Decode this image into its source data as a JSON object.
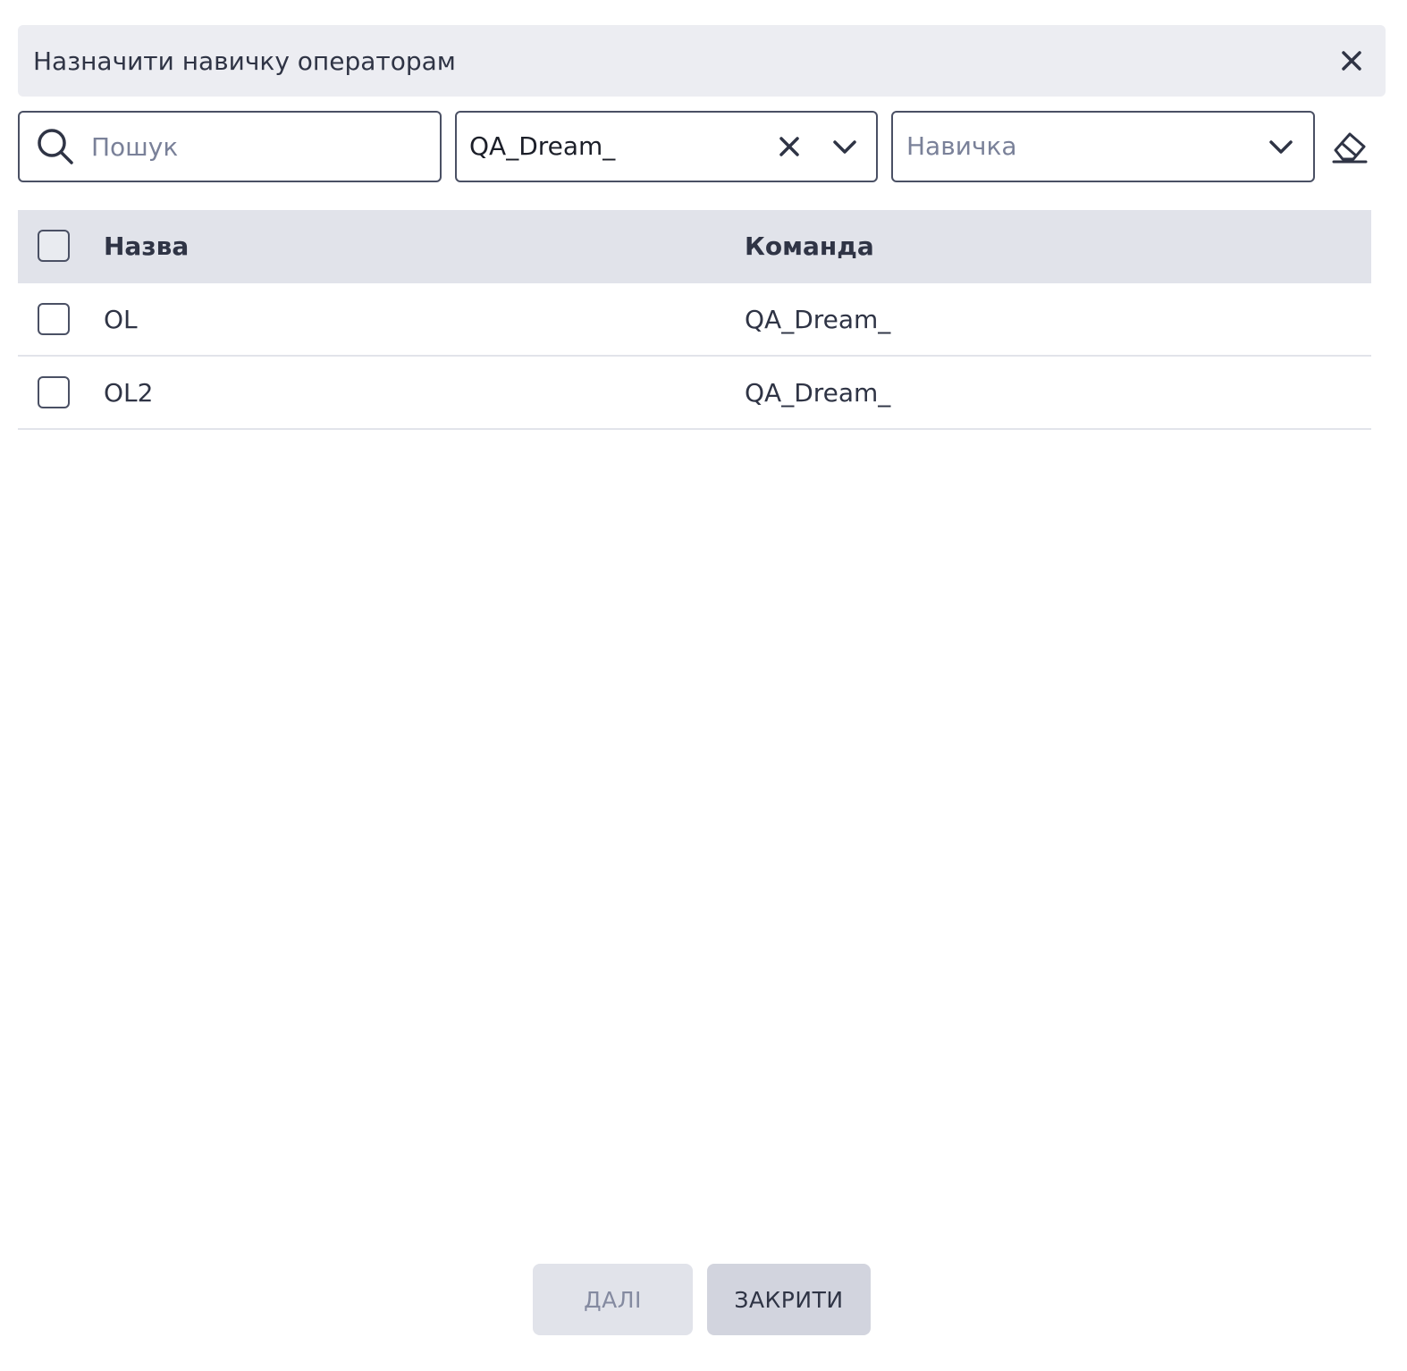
{
  "dialog": {
    "title": "Назначити навичку операторам",
    "close_icon": "close-icon"
  },
  "filters": {
    "search": {
      "value": "",
      "placeholder": "Пошук",
      "icon": "search-icon"
    },
    "team": {
      "selected": "QA_Dream_",
      "clear_icon": "close-icon",
      "dropdown_icon": "chevron-down-icon"
    },
    "skill": {
      "placeholder": "Навичка",
      "dropdown_icon": "chevron-down-icon"
    },
    "reset_icon": "eraser-icon"
  },
  "table": {
    "columns": [
      "Назва",
      "Команда"
    ],
    "rows": [
      {
        "name": "OL",
        "team": "QA_Dream_",
        "checked": false
      },
      {
        "name": "OL2",
        "team": "QA_Dream_",
        "checked": false
      }
    ]
  },
  "footer": {
    "next_label": "ДАЛІ",
    "close_label": "ЗАКРИТИ"
  },
  "colors": {
    "header_bg": "#ecedf2",
    "table_header_bg": "#e1e3ea",
    "border": "#4a5064",
    "text": "#2f3445",
    "placeholder": "#7a8199"
  }
}
